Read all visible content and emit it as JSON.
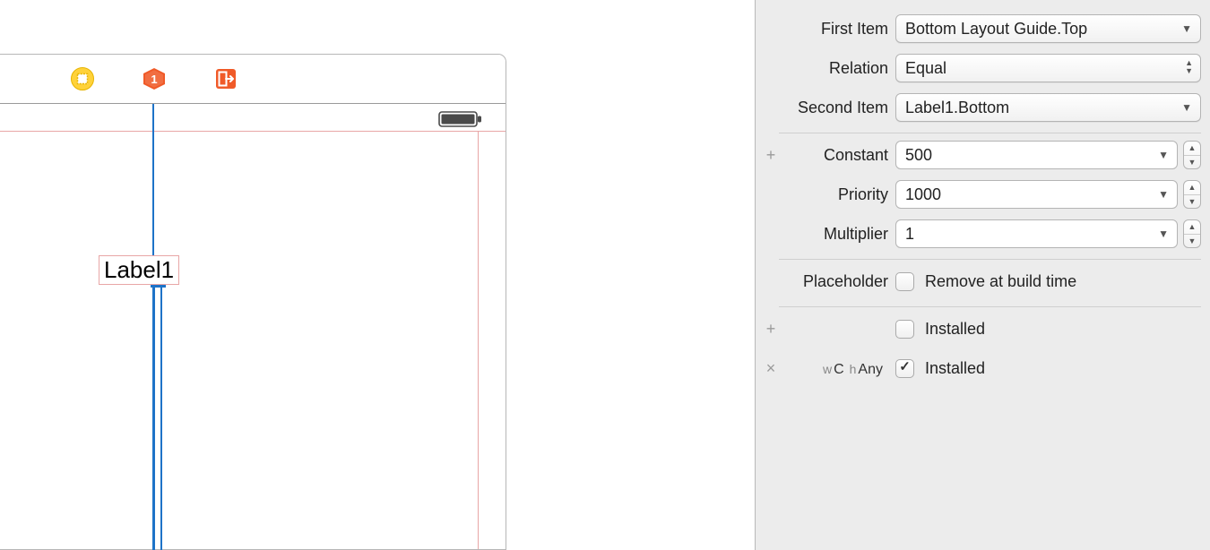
{
  "canvas": {
    "label_text": "Label1"
  },
  "inspector": {
    "first_item": {
      "label": "First Item",
      "value": "Bottom Layout Guide.Top"
    },
    "relation": {
      "label": "Relation",
      "value": "Equal"
    },
    "second_item": {
      "label": "Second Item",
      "value": "Label1.Bottom"
    },
    "constant": {
      "label": "Constant",
      "value": "500"
    },
    "priority": {
      "label": "Priority",
      "value": "1000"
    },
    "multiplier": {
      "label": "Multiplier",
      "value": "1"
    },
    "placeholder": {
      "label": "Placeholder",
      "checkbox_label": "Remove at build time",
      "checked": false
    },
    "installed_rows": [
      {
        "gutter": "+",
        "size_class": "",
        "label_text": "Installed",
        "checked": false
      },
      {
        "gutter": "×",
        "size_class_w": "w",
        "size_class_wv": "C",
        "size_class_h": "h",
        "size_class_hv": "Any",
        "label_text": "Installed",
        "checked": true
      }
    ]
  }
}
